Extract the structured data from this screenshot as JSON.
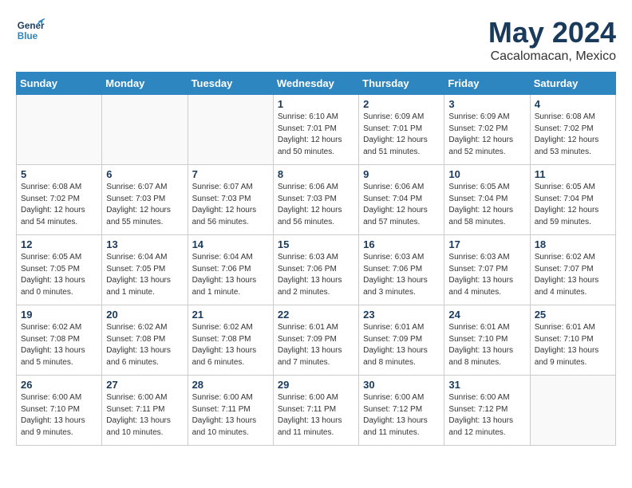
{
  "header": {
    "logo_general": "General",
    "logo_blue": "Blue",
    "month_year": "May 2024",
    "location": "Cacalomacan, Mexico"
  },
  "days_of_week": [
    "Sunday",
    "Monday",
    "Tuesday",
    "Wednesday",
    "Thursday",
    "Friday",
    "Saturday"
  ],
  "weeks": [
    [
      {
        "day": "",
        "info": ""
      },
      {
        "day": "",
        "info": ""
      },
      {
        "day": "",
        "info": ""
      },
      {
        "day": "1",
        "info": "Sunrise: 6:10 AM\nSunset: 7:01 PM\nDaylight: 12 hours\nand 50 minutes."
      },
      {
        "day": "2",
        "info": "Sunrise: 6:09 AM\nSunset: 7:01 PM\nDaylight: 12 hours\nand 51 minutes."
      },
      {
        "day": "3",
        "info": "Sunrise: 6:09 AM\nSunset: 7:02 PM\nDaylight: 12 hours\nand 52 minutes."
      },
      {
        "day": "4",
        "info": "Sunrise: 6:08 AM\nSunset: 7:02 PM\nDaylight: 12 hours\nand 53 minutes."
      }
    ],
    [
      {
        "day": "5",
        "info": "Sunrise: 6:08 AM\nSunset: 7:02 PM\nDaylight: 12 hours\nand 54 minutes."
      },
      {
        "day": "6",
        "info": "Sunrise: 6:07 AM\nSunset: 7:03 PM\nDaylight: 12 hours\nand 55 minutes."
      },
      {
        "day": "7",
        "info": "Sunrise: 6:07 AM\nSunset: 7:03 PM\nDaylight: 12 hours\nand 56 minutes."
      },
      {
        "day": "8",
        "info": "Sunrise: 6:06 AM\nSunset: 7:03 PM\nDaylight: 12 hours\nand 56 minutes."
      },
      {
        "day": "9",
        "info": "Sunrise: 6:06 AM\nSunset: 7:04 PM\nDaylight: 12 hours\nand 57 minutes."
      },
      {
        "day": "10",
        "info": "Sunrise: 6:05 AM\nSunset: 7:04 PM\nDaylight: 12 hours\nand 58 minutes."
      },
      {
        "day": "11",
        "info": "Sunrise: 6:05 AM\nSunset: 7:04 PM\nDaylight: 12 hours\nand 59 minutes."
      }
    ],
    [
      {
        "day": "12",
        "info": "Sunrise: 6:05 AM\nSunset: 7:05 PM\nDaylight: 13 hours\nand 0 minutes."
      },
      {
        "day": "13",
        "info": "Sunrise: 6:04 AM\nSunset: 7:05 PM\nDaylight: 13 hours\nand 1 minute."
      },
      {
        "day": "14",
        "info": "Sunrise: 6:04 AM\nSunset: 7:06 PM\nDaylight: 13 hours\nand 1 minute."
      },
      {
        "day": "15",
        "info": "Sunrise: 6:03 AM\nSunset: 7:06 PM\nDaylight: 13 hours\nand 2 minutes."
      },
      {
        "day": "16",
        "info": "Sunrise: 6:03 AM\nSunset: 7:06 PM\nDaylight: 13 hours\nand 3 minutes."
      },
      {
        "day": "17",
        "info": "Sunrise: 6:03 AM\nSunset: 7:07 PM\nDaylight: 13 hours\nand 4 minutes."
      },
      {
        "day": "18",
        "info": "Sunrise: 6:02 AM\nSunset: 7:07 PM\nDaylight: 13 hours\nand 4 minutes."
      }
    ],
    [
      {
        "day": "19",
        "info": "Sunrise: 6:02 AM\nSunset: 7:08 PM\nDaylight: 13 hours\nand 5 minutes."
      },
      {
        "day": "20",
        "info": "Sunrise: 6:02 AM\nSunset: 7:08 PM\nDaylight: 13 hours\nand 6 minutes."
      },
      {
        "day": "21",
        "info": "Sunrise: 6:02 AM\nSunset: 7:08 PM\nDaylight: 13 hours\nand 6 minutes."
      },
      {
        "day": "22",
        "info": "Sunrise: 6:01 AM\nSunset: 7:09 PM\nDaylight: 13 hours\nand 7 minutes."
      },
      {
        "day": "23",
        "info": "Sunrise: 6:01 AM\nSunset: 7:09 PM\nDaylight: 13 hours\nand 8 minutes."
      },
      {
        "day": "24",
        "info": "Sunrise: 6:01 AM\nSunset: 7:10 PM\nDaylight: 13 hours\nand 8 minutes."
      },
      {
        "day": "25",
        "info": "Sunrise: 6:01 AM\nSunset: 7:10 PM\nDaylight: 13 hours\nand 9 minutes."
      }
    ],
    [
      {
        "day": "26",
        "info": "Sunrise: 6:00 AM\nSunset: 7:10 PM\nDaylight: 13 hours\nand 9 minutes."
      },
      {
        "day": "27",
        "info": "Sunrise: 6:00 AM\nSunset: 7:11 PM\nDaylight: 13 hours\nand 10 minutes."
      },
      {
        "day": "28",
        "info": "Sunrise: 6:00 AM\nSunset: 7:11 PM\nDaylight: 13 hours\nand 10 minutes."
      },
      {
        "day": "29",
        "info": "Sunrise: 6:00 AM\nSunset: 7:11 PM\nDaylight: 13 hours\nand 11 minutes."
      },
      {
        "day": "30",
        "info": "Sunrise: 6:00 AM\nSunset: 7:12 PM\nDaylight: 13 hours\nand 11 minutes."
      },
      {
        "day": "31",
        "info": "Sunrise: 6:00 AM\nSunset: 7:12 PM\nDaylight: 13 hours\nand 12 minutes."
      },
      {
        "day": "",
        "info": ""
      }
    ]
  ]
}
